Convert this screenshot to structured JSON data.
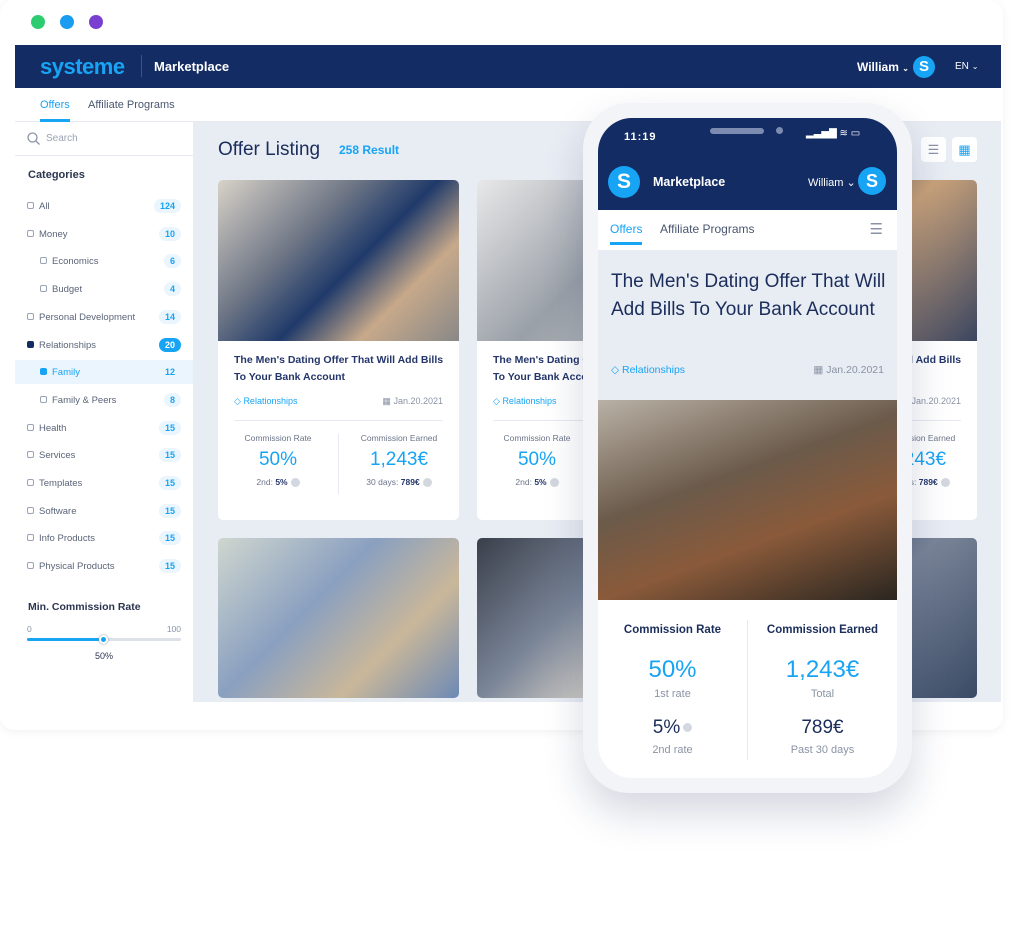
{
  "window": {
    "dots": [
      "#2ecc71",
      "#1a9cf0",
      "#7a3fd0"
    ]
  },
  "header": {
    "logo": "systeme",
    "section": "Marketplace",
    "user": "William",
    "avatar": "S",
    "lang": "EN"
  },
  "tabs": [
    {
      "label": "Offers",
      "active": true
    },
    {
      "label": "Affiliate Programs",
      "active": false
    }
  ],
  "sidebar": {
    "search_placeholder": "Search",
    "categories_title": "Categories",
    "categories": [
      {
        "label": "All",
        "count": "124",
        "level": 0
      },
      {
        "label": "Money",
        "count": "10",
        "level": 0
      },
      {
        "label": "Economics",
        "count": "6",
        "level": 1
      },
      {
        "label": "Budget",
        "count": "4",
        "level": 1
      },
      {
        "label": "Personal Development",
        "count": "14",
        "level": 0
      },
      {
        "label": "Relationships",
        "count": "20",
        "level": 0,
        "selected": true
      },
      {
        "label": "Family",
        "count": "12",
        "level": 1,
        "active": true
      },
      {
        "label": "Family & Peers",
        "count": "8",
        "level": 1
      },
      {
        "label": "Health",
        "count": "15",
        "level": 0
      },
      {
        "label": "Services",
        "count": "15",
        "level": 0
      },
      {
        "label": "Templates",
        "count": "15",
        "level": 0
      },
      {
        "label": "Software",
        "count": "15",
        "level": 0
      },
      {
        "label": "Info Products",
        "count": "15",
        "level": 0
      },
      {
        "label": "Physical Products",
        "count": "15",
        "level": 0
      }
    ],
    "slider": {
      "title": "Min. Commission Rate",
      "min": "0",
      "max": "100",
      "value": "50%",
      "percent": 50
    }
  },
  "main": {
    "title": "Offer Listing",
    "result": "258 Result",
    "card": {
      "title": "The Men's Dating Offer That Will Add Bills To Your Bank Account",
      "tag": "Relationships",
      "date": "Jan.20.2021",
      "rate_label": "Commission Rate",
      "rate": "50%",
      "second_label": "2nd:",
      "second": "5%",
      "earned_label": "Commission Earned",
      "earned": "1,243€",
      "days_label": "30 days:",
      "days": "789€"
    },
    "card2_partial": {
      "title_end": "Will Add",
      "earned_end": "43€",
      "earned_label_end": "on Earned"
    }
  },
  "phone": {
    "time": "11:19",
    "section": "Marketplace",
    "user": "William",
    "avatar": "S",
    "tabs": [
      "Offers",
      "Affiliate Programs"
    ],
    "title": "The Men's Dating Offer That Will Add Bills To Your Bank Account",
    "tag": "Relationships",
    "date": "Jan.20.2021",
    "rate_label": "Commission Rate",
    "rate": "50%",
    "rate_sub": "1st rate",
    "second": "5%",
    "second_sub": "2nd rate",
    "earned_label": "Commission Earned",
    "earned": "1,243€",
    "earned_sub": "Total",
    "days": "789€",
    "days_sub": "Past 30 days"
  }
}
